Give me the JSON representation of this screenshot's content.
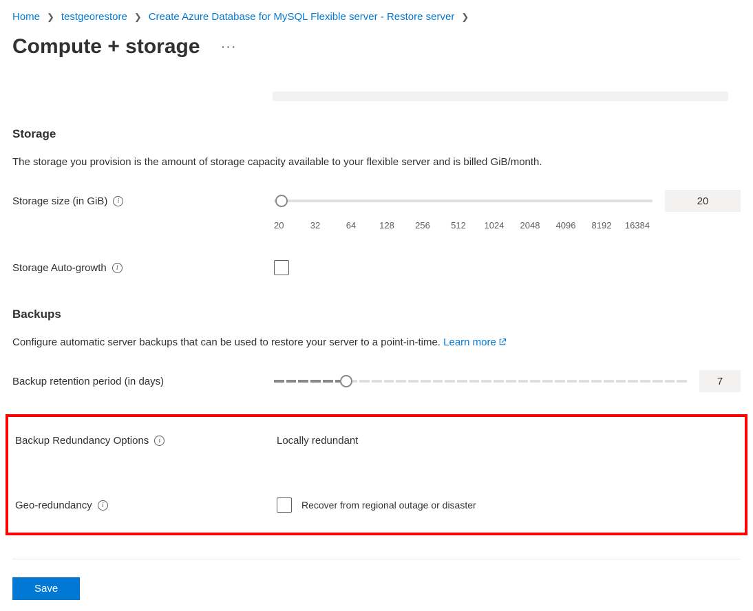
{
  "breadcrumb": {
    "items": [
      {
        "label": "Home"
      },
      {
        "label": "testgeorestore"
      },
      {
        "label": "Create Azure Database for MySQL Flexible server - Restore server"
      }
    ]
  },
  "page": {
    "title": "Compute + storage"
  },
  "storage": {
    "heading": "Storage",
    "description": "The storage you provision is the amount of storage capacity available to your flexible server and is billed GiB/month.",
    "size_label": "Storage size (in GiB)",
    "size_value": "20",
    "ticks": [
      "20",
      "32",
      "64",
      "128",
      "256",
      "512",
      "1024",
      "2048",
      "4096",
      "8192",
      "16384"
    ],
    "auto_growth_label": "Storage Auto-growth"
  },
  "backups": {
    "heading": "Backups",
    "description_prefix": "Configure automatic server backups that can be used to restore your server to a point-in-time. ",
    "learn_more_label": "Learn more",
    "retention_label": "Backup retention period (in days)",
    "retention_value": "7",
    "redundancy_label": "Backup Redundancy Options",
    "redundancy_value": "Locally redundant",
    "geo_label": "Geo-redundancy",
    "geo_checkbox_label": "Recover from regional outage or disaster"
  },
  "actions": {
    "save": "Save"
  }
}
